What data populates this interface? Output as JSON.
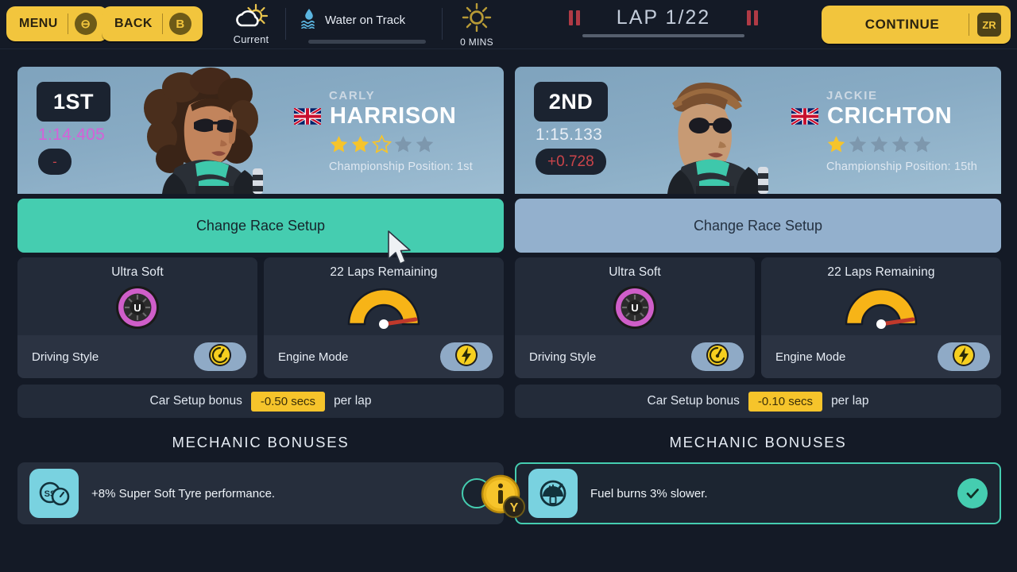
{
  "header": {
    "menu_button": {
      "label": "MENU",
      "keycap": "⊖",
      "icon": "minus-keycap-icon"
    },
    "back_button": {
      "label": "BACK",
      "keycap": "B",
      "icon": "b-keycap-icon"
    },
    "weather": {
      "caption": "Current",
      "icon": "sun-behind-cloud-icon"
    },
    "water": {
      "label": "Water on Track",
      "icon": "water-droplet-waves-icon",
      "level_percent": 0
    },
    "sun": {
      "caption": "0 MINS",
      "icon": "sun-icon"
    },
    "lap": {
      "label": "LAP 1/22",
      "current": 1,
      "total": 22,
      "left_icon": "pause-icon",
      "right_icon": "pause-icon"
    },
    "continue_button": {
      "label": "CONTINUE",
      "keycap": "ZR",
      "icon": "zr-keycap-icon"
    }
  },
  "info_button": {
    "label": "i",
    "keycap": "Y",
    "icon": "info-circle-icon"
  },
  "drivers": [
    {
      "position": "1ST",
      "lap_time": "1:14.405",
      "lap_time_state": "fastest",
      "delta": "-",
      "delta_state": "dash",
      "first_name": "CARLY",
      "last_name": "HARRISON",
      "country": "United Kingdom",
      "flag_icon": "union-jack-flag-icon",
      "stars_filled": 2,
      "stars_outline": 1,
      "stars_total": 5,
      "championship_label": "Championship Position:",
      "championship_value": "1st",
      "change_setup_label": "Change Race Setup",
      "change_setup_state": "active",
      "tyre": {
        "title": "Ultra Soft",
        "code": "U",
        "icon": "tyre-icon",
        "color": "#cf5ec9"
      },
      "fuel": {
        "title": "22 Laps Remaining",
        "icon": "fuel-gauge-icon",
        "needle_percent": 97
      },
      "driving_style": {
        "label": "Driving Style",
        "icon": "speedometer-coin-icon"
      },
      "engine_mode": {
        "label": "Engine Mode",
        "icon": "lightning-coin-icon"
      },
      "car_setup": {
        "prefix": "Car Setup bonus",
        "value": "-0.50 secs",
        "suffix": "per lap"
      },
      "mechanic_header": "MECHANIC BONUSES",
      "mechanic_bonuses": [
        {
          "text": "+8% Super Soft Tyre performance.",
          "icon": "super-soft-tyre-icon",
          "selected": false,
          "check_icon": "empty-circle-icon"
        }
      ]
    },
    {
      "position": "2ND",
      "lap_time": "1:15.133",
      "lap_time_state": "normal",
      "delta": "+0.728",
      "delta_state": "behind",
      "first_name": "JACKIE",
      "last_name": "CRICHTON",
      "country": "United Kingdom",
      "flag_icon": "union-jack-flag-icon",
      "stars_filled": 1,
      "stars_outline": 0,
      "stars_total": 5,
      "championship_label": "Championship Position:",
      "championship_value": "15th",
      "change_setup_label": "Change Race Setup",
      "change_setup_state": "inactive",
      "tyre": {
        "title": "Ultra Soft",
        "code": "U",
        "icon": "tyre-icon",
        "color": "#cf5ec9"
      },
      "fuel": {
        "title": "22 Laps Remaining",
        "icon": "fuel-gauge-icon",
        "needle_percent": 97
      },
      "driving_style": {
        "label": "Driving Style",
        "icon": "speedometer-coin-icon"
      },
      "engine_mode": {
        "label": "Engine Mode",
        "icon": "lightning-coin-icon"
      },
      "car_setup": {
        "prefix": "Car Setup bonus",
        "value": "-0.10 secs",
        "suffix": "per lap"
      },
      "mechanic_header": "MECHANIC BONUSES",
      "mechanic_bonuses": [
        {
          "text": "Fuel burns 3% slower.",
          "icon": "fuel-economy-icon",
          "selected": true,
          "check_icon": "check-icon"
        }
      ]
    }
  ],
  "colors": {
    "background": "#141a26",
    "accent_yellow": "#f2c53d",
    "accent_teal": "#45cdb0",
    "panel": "#232b39",
    "card_blue": "#8cafc7",
    "fastest_purple": "#d461d8",
    "delta_red": "#c9444a",
    "icon_cyan": "#79d2e0"
  }
}
